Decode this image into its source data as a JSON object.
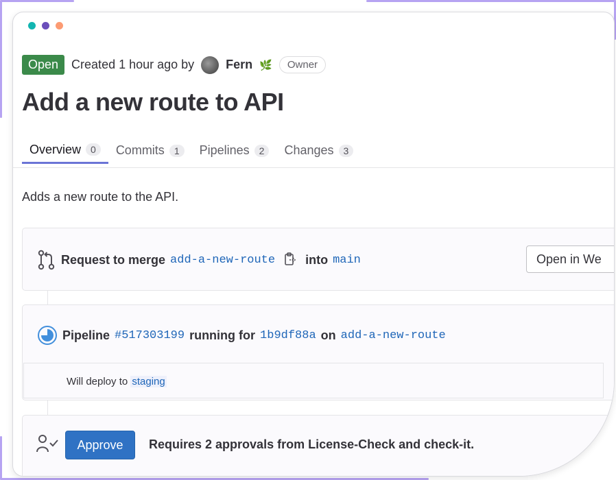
{
  "window": {
    "traffic_lights": [
      "#13b5b1",
      "#6b4fbb",
      "#fc9b73"
    ]
  },
  "header": {
    "status_badge": "Open",
    "created_text": "Created 1 hour ago by",
    "author": "Fern",
    "author_emoji": "🌿",
    "role_badge": "Owner"
  },
  "title": "Add a new route to API",
  "tabs": [
    {
      "label": "Overview",
      "count": "0"
    },
    {
      "label": "Commits",
      "count": "1"
    },
    {
      "label": "Pipelines",
      "count": "2"
    },
    {
      "label": "Changes",
      "count": "3"
    }
  ],
  "description": "Adds a new route to the API.",
  "merge": {
    "prefix": "Request to merge",
    "source_branch": "add-a-new-route",
    "into": "into",
    "target_branch": "main",
    "open_in_button": "Open in We"
  },
  "pipeline": {
    "prefix": "Pipeline",
    "id": "#517303199",
    "running_for": "running for",
    "commit": "1b9df88a",
    "on": "on",
    "branch": "add-a-new-route",
    "deploy_text": "Will deploy to",
    "environment": "staging"
  },
  "approval": {
    "button_label": "Approve",
    "requirement_text": "Requires 2 approvals from License-Check and check-it."
  },
  "colors": {
    "open_badge": "#3b8a4a",
    "link": "#1f66b8",
    "active_tab_underline": "#6b74d6",
    "approve_button": "#2f72c4",
    "accent_frame": "#b6a3f2"
  }
}
